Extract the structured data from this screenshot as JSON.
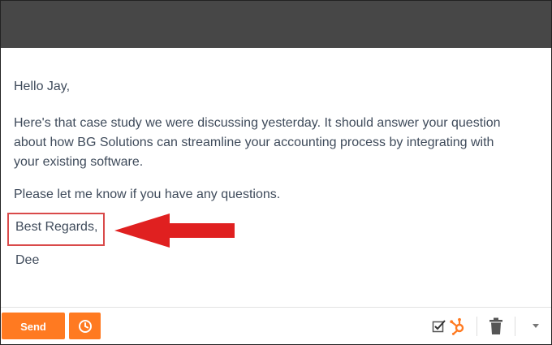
{
  "email": {
    "greeting": "Hello Jay,",
    "paragraph1_lines": [
      "Here's that case study we were discussing yesterday. It should answer your question",
      "about how BG Solutions can streamline your accounting process by integrating with",
      "your existing software."
    ],
    "paragraph2": "Please let me know if you have any questions.",
    "closing": "Best Regards,",
    "signature": "Dee"
  },
  "toolbar": {
    "send_label": "Send",
    "schedule_icon": "clock-icon",
    "checkbox_icon": "checkbox-checked-icon",
    "hubspot_icon": "hubspot-sprocket-icon",
    "trash_icon": "trash-icon",
    "dropdown_icon": "chevron-down-icon"
  },
  "colors": {
    "header": "#474747",
    "accent": "#ff7a21",
    "annotation": "#e02020",
    "body_text": "#3f4b5b"
  }
}
